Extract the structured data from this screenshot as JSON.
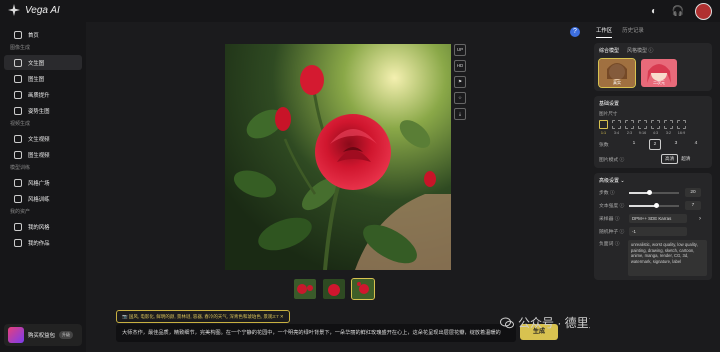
{
  "app": {
    "name": "Vega AI"
  },
  "colors": {
    "accent": "#d8c250",
    "background": "#1b1b1d",
    "sidebar": "#161618",
    "help": "#3d6fe0"
  },
  "topbar": {
    "icons": [
      "theme-icon",
      "headset-icon",
      "user-avatar"
    ]
  },
  "sidebar": {
    "sections": [
      {
        "title": "",
        "items": [
          {
            "label": "首页",
            "icon": "home-icon"
          }
        ]
      },
      {
        "title": "图像生成",
        "items": [
          {
            "label": "文生图",
            "icon": "text-to-image-icon",
            "active": true
          },
          {
            "label": "图生图",
            "icon": "image-to-image-icon"
          },
          {
            "label": "画质提升",
            "icon": "upscale-icon"
          },
          {
            "label": "姿势生图",
            "icon": "pose-icon"
          }
        ]
      },
      {
        "title": "视频生成",
        "items": [
          {
            "label": "文生视频",
            "icon": "text-to-video-icon"
          },
          {
            "label": "图生视频",
            "icon": "image-to-video-icon"
          }
        ]
      },
      {
        "title": "模型训练",
        "items": [
          {
            "label": "风格广场",
            "icon": "style-square-icon"
          },
          {
            "label": "风格训练",
            "icon": "style-train-icon"
          }
        ]
      },
      {
        "title": "我的资产",
        "items": [
          {
            "label": "我的风格",
            "icon": "my-style-icon"
          },
          {
            "label": "我的作品",
            "icon": "my-works-icon"
          }
        ]
      }
    ],
    "promo": {
      "label": "购买权益包",
      "badge": "升级"
    }
  },
  "main": {
    "help": "?",
    "tools": [
      "UP",
      "HD",
      "⚑",
      "☆",
      "⤓"
    ],
    "tags": "📷 国风, 电影化, 鲜明的颜, 景林谜, 容器, 春冷的天气, 深青色和琥珀色, 景观3:7 ✕",
    "prompt": "大师杰作，最佳品质，精致细节，完美构图。在一个宁静的花园中，一个明亮的绿叶背景下，一朵华丽的鲜红玫瑰盛开在心上，这朵花呈现出层层花瓣，绽放着温暖的",
    "generate": "生成",
    "thumbs": 3
  },
  "watermark": "公众号 · 德里克文",
  "rpanel": {
    "tabs": [
      "工作区",
      "历史记录"
    ],
    "model_tabs": [
      "综合模型",
      "风格模型 ⓘ"
    ],
    "models": [
      {
        "label": "真实",
        "selected": true
      },
      {
        "label": "二次元",
        "selected": false
      }
    ],
    "basic_title": "基础设置",
    "size_label": "图片尺寸",
    "ratios": [
      {
        "label": "1:1",
        "selected": true
      },
      {
        "label": "3:4"
      },
      {
        "label": "2:3"
      },
      {
        "label": "9:16"
      },
      {
        "label": "4:3"
      },
      {
        "label": "3:2"
      },
      {
        "label": "16:9"
      }
    ],
    "count_label": "张数",
    "counts": [
      "1",
      "2",
      "3",
      "4"
    ],
    "count_selected": 1,
    "mode_label": "图片模式 ⓘ",
    "modes": [
      "高清",
      "超清"
    ],
    "advanced_title": "高级设置 ⌄",
    "steps": {
      "label": "步数 ⓘ",
      "value": "20",
      "fraction": 0.4
    },
    "text_strength": {
      "label": "文本强度 ⓘ",
      "value": "7",
      "fraction": 0.55
    },
    "sampler": {
      "label": "采样器 ⓘ",
      "value": "DPM++ SDE Karras"
    },
    "seed": {
      "label": "随机种子 ⓘ",
      "value": "-1"
    },
    "negative": {
      "label": "负面词 ⓘ",
      "value": "unrealistic, worst quality, low quality, painting, drawing, sketch, cartoon, anime, manga, render, CG, 3d, watermark, signature, label"
    }
  }
}
